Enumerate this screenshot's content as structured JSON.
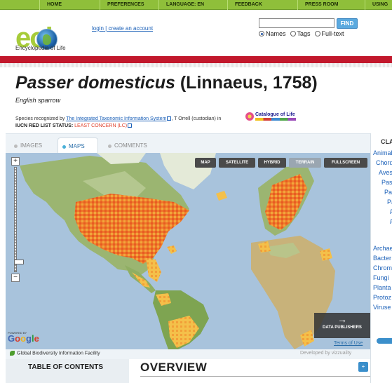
{
  "topnav": {
    "items": [
      "HOME",
      "PREFERENCES",
      "LANGUAGE: EN",
      "FEEDBACK",
      "PRESS ROOM",
      "USING"
    ]
  },
  "header": {
    "logo_text": "eol",
    "logo_caption": "Encyclopedia of Life",
    "login": "login",
    "separator": "|",
    "create_account": "create an account",
    "search_value": "",
    "find_label": "FIND",
    "search_options": [
      "Names",
      "Tags",
      "Full-text"
    ],
    "selected_option": "Names"
  },
  "taxon": {
    "scientific_name": "Passer domesticus",
    "authority": "(Linnaeus, 1758)",
    "common_name": "English sparrow",
    "recognized_prefix": "Species recognized by",
    "recognized_source": "The Integrated Taxonomic Information System",
    "curator": "T Orrell (custodian) in",
    "catalogue": "Catalogue of Life",
    "iucn_label": "IUCN RED LIST STATUS:",
    "iucn_status": "LEAST CONCERN (LC)"
  },
  "tabs": [
    "IMAGES",
    "MAPS",
    "COMMENTS"
  ],
  "active_tab": "MAPS",
  "map": {
    "view_buttons": [
      "MAP",
      "SATELLITE",
      "HYBRID",
      "TERRAIN",
      "FULLSCREEN"
    ],
    "selected_view": "TERRAIN",
    "zoom_in": "+",
    "zoom_out": "−",
    "powered_by": "POWERED BY",
    "google": [
      "G",
      "o",
      "o",
      "g",
      "l",
      "e"
    ],
    "publishers_label": "DATA PUBLISHERS",
    "terms": "Terms of Use",
    "attribution": "Global Biodiversity Information Facility",
    "developer": "Developed by vizzuality"
  },
  "toc_title": "TABLE OF CONTENTS",
  "overview_title": "OVERVIEW",
  "sidebar": {
    "heading": "CLA",
    "items": [
      "Animal",
      "Chorda",
      "Aves",
      "Pas",
      "Pas",
      "Pa",
      "P",
      "P",
      "Archae",
      "Bacter",
      "Chrom",
      "Fungi",
      "Planta",
      "Protoz",
      "Viruse"
    ]
  },
  "colors": {
    "nav_green": "#8fbf3a",
    "brand_red": "#c2182c",
    "link_blue": "#1b60b8",
    "iucn_orange": "#e0412c"
  }
}
